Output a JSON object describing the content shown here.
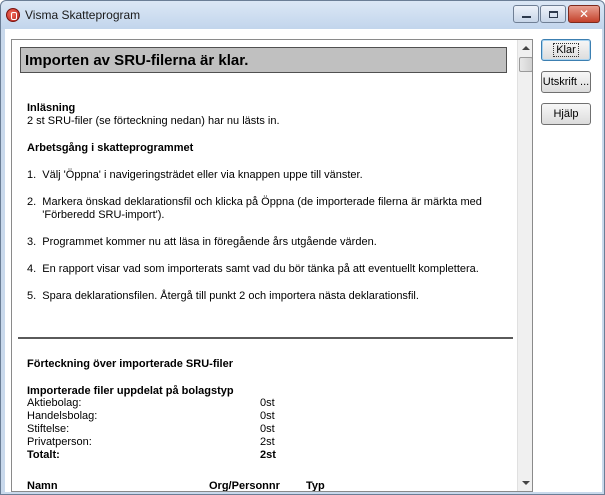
{
  "window": {
    "title": "Visma Skatteprogram",
    "icon": "visma-app-icon",
    "controls": {
      "minimize": "minimize-icon",
      "maximize": "maximize-icon",
      "close": "✕"
    }
  },
  "report": {
    "heading": "Importen av SRU-filerna är klar.",
    "inlasning_title": "Inläsning",
    "inlasning_text": "2 st SRU-filer (se förteckning nedan) har nu lästs in.",
    "arbetsgang_title": "Arbetsgång i skatteprogrammet",
    "steps": [
      "1.  Välj 'Öppna' i navigeringsträdet eller via knappen uppe till vänster.",
      "2.  Markera önskad deklarationsfil och klicka på Öppna (de importerade filerna är märkta med",
      "     'Förberedd SRU-import').",
      "3.  Programmet kommer nu att läsa in föregående års utgående värden.",
      "4.  En rapport visar vad som importerats samt vad du bör tänka på att eventuellt komplettera.",
      "5.  Spara deklarationsfilen. Återgå till punkt 2 och importera nästa deklarationsfil."
    ],
    "list_title": "Förteckning över importerade SRU-filer",
    "split_title": "Importerade filer uppdelat på bolagstyp",
    "counts": [
      {
        "label": "Aktiebolag:",
        "value": "0st"
      },
      {
        "label": "Handelsbolag:",
        "value": "0st"
      },
      {
        "label": "Stiftelse:",
        "value": "0st"
      },
      {
        "label": "Privatperson:",
        "value": "2st"
      }
    ],
    "total_label": "Totalt:",
    "total_value": "2st",
    "columns": {
      "name": "Namn",
      "orgnr": "Org/Personnr",
      "type": "Typ"
    }
  },
  "buttons": {
    "klar": "Klar",
    "utskrift": "Utskrift ...",
    "hjalp": "Hjälp"
  }
}
